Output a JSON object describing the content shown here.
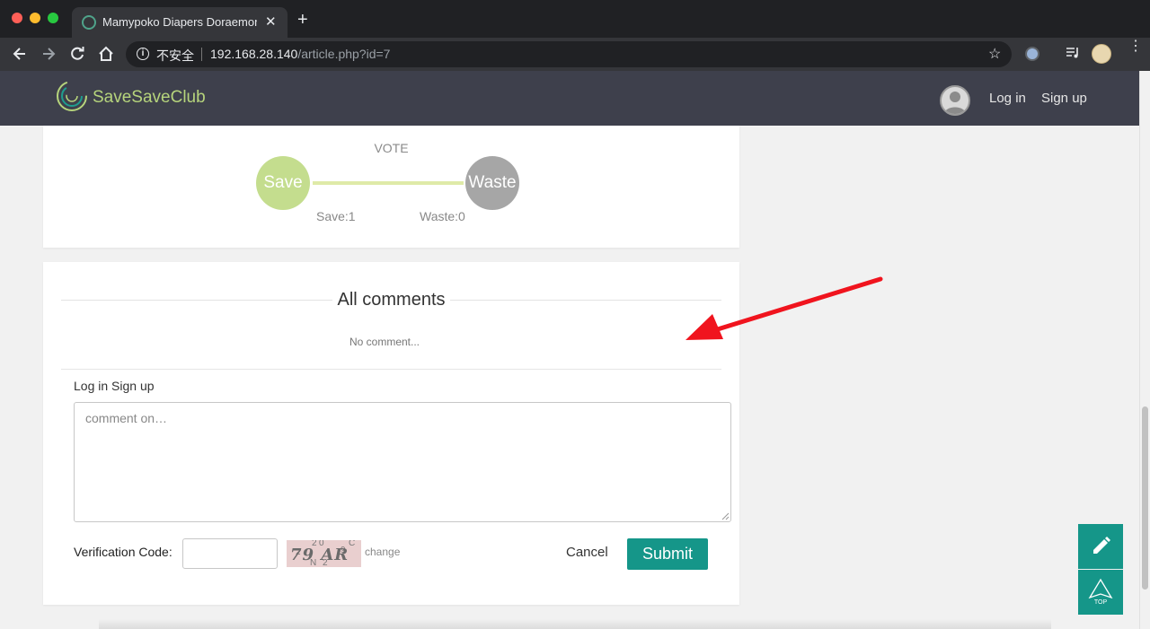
{
  "browser": {
    "tab_title": "Mamypoko Diapers Doraemon",
    "tab_close": "✕",
    "new_tab": "+",
    "security_label": "不安全",
    "url_host": "192.168.28.140",
    "url_path": "/article.php?id=7",
    "star": "☆"
  },
  "site": {
    "logo_text": "SaveSaveClub",
    "nav": {
      "login": "Log in",
      "signup": "Sign up"
    }
  },
  "vote": {
    "title": "VOTE",
    "save_label": "Save",
    "waste_label": "Waste",
    "save_count": "Save:1",
    "waste_count": "Waste:0"
  },
  "comments": {
    "title": "All comments",
    "empty_text": "No comment...",
    "login_link": "Log in",
    "signup_link": "Sign up",
    "placeholder": "comment on…",
    "verify_label": "Verification Code:",
    "captcha_text": "79 AR",
    "captcha_noise": [
      "2",
      "0",
      "C",
      "2",
      "N",
      "2",
      "9"
    ],
    "change_label": "change",
    "cancel_label": "Cancel",
    "submit_label": "Submit"
  },
  "floating": {
    "top_label": "TOP"
  },
  "colors": {
    "brand_teal": "#159689",
    "save_green": "#c4dd8e",
    "waste_gray": "#a6a6a6",
    "header_bg": "#3e404c",
    "annotation_red": "#f0141e"
  }
}
